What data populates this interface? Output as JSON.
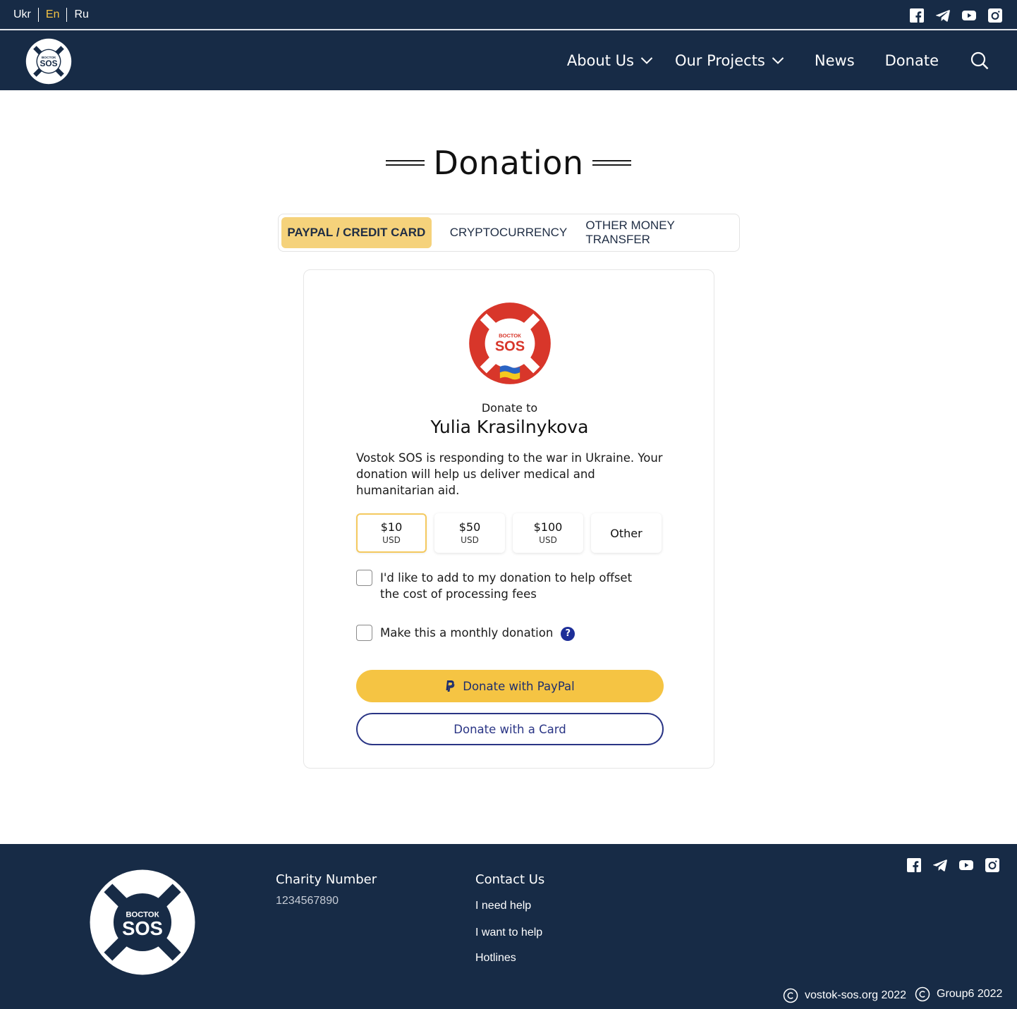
{
  "languages": [
    {
      "label": "Ukr",
      "active": false
    },
    {
      "label": "En",
      "active": true
    },
    {
      "label": "Ru",
      "active": false
    }
  ],
  "brand": {
    "logo_top_text": "ВОСТОК",
    "logo_main_text": "SOS"
  },
  "nav": {
    "about": "About Us",
    "projects": "Our Projects",
    "news": "News",
    "donate": "Donate"
  },
  "page": {
    "title": "Donation"
  },
  "tabs": [
    {
      "label": "PAYPAL / CREDIT CARD",
      "active": true
    },
    {
      "label": "CRYPTOCURRENCY",
      "active": false
    },
    {
      "label": "OTHER MONEY TRANSFER",
      "active": false
    }
  ],
  "donation": {
    "donate_to": "Donate to",
    "recipient": "Yulia Krasilnykova",
    "description": "Vostok SOS is responding to the war in Ukraine. Your donation will help us deliver medical and humanitarian aid.",
    "amounts": [
      {
        "value": "$10",
        "unit": "USD",
        "selected": true
      },
      {
        "value": "$50",
        "unit": "USD",
        "selected": false
      },
      {
        "value": "$100",
        "unit": "USD",
        "selected": false
      }
    ],
    "other_label": "Other",
    "fees_label": "I'd like to add to my donation to help offset the cost of processing fees",
    "monthly_label": "Make this a monthly donation",
    "help_glyph": "?",
    "paypal_button": "Donate with PayPal",
    "card_button": "Donate with a Card"
  },
  "footer": {
    "charity_heading": "Charity Number",
    "charity_number": "1234567890",
    "contact_heading": "Contact Us",
    "links": [
      "I need help",
      "I want to help",
      "Hotlines"
    ],
    "copyright_1": "vostok-sos.org 2022",
    "copyright_2": "Group6 2022"
  },
  "icons": {
    "social": [
      "facebook-icon",
      "telegram-icon",
      "youtube-icon",
      "instagram-icon"
    ],
    "search": "search-icon",
    "chevron": "chevron-down-icon",
    "paypal": "paypal-icon",
    "copyright": "copyright-icon"
  },
  "colors": {
    "navy": "#172b46",
    "accent_yellow": "#f5c443",
    "active_tab": "#f5d27b",
    "card_button": "#2a3585",
    "logo_red": "#d8362a"
  }
}
